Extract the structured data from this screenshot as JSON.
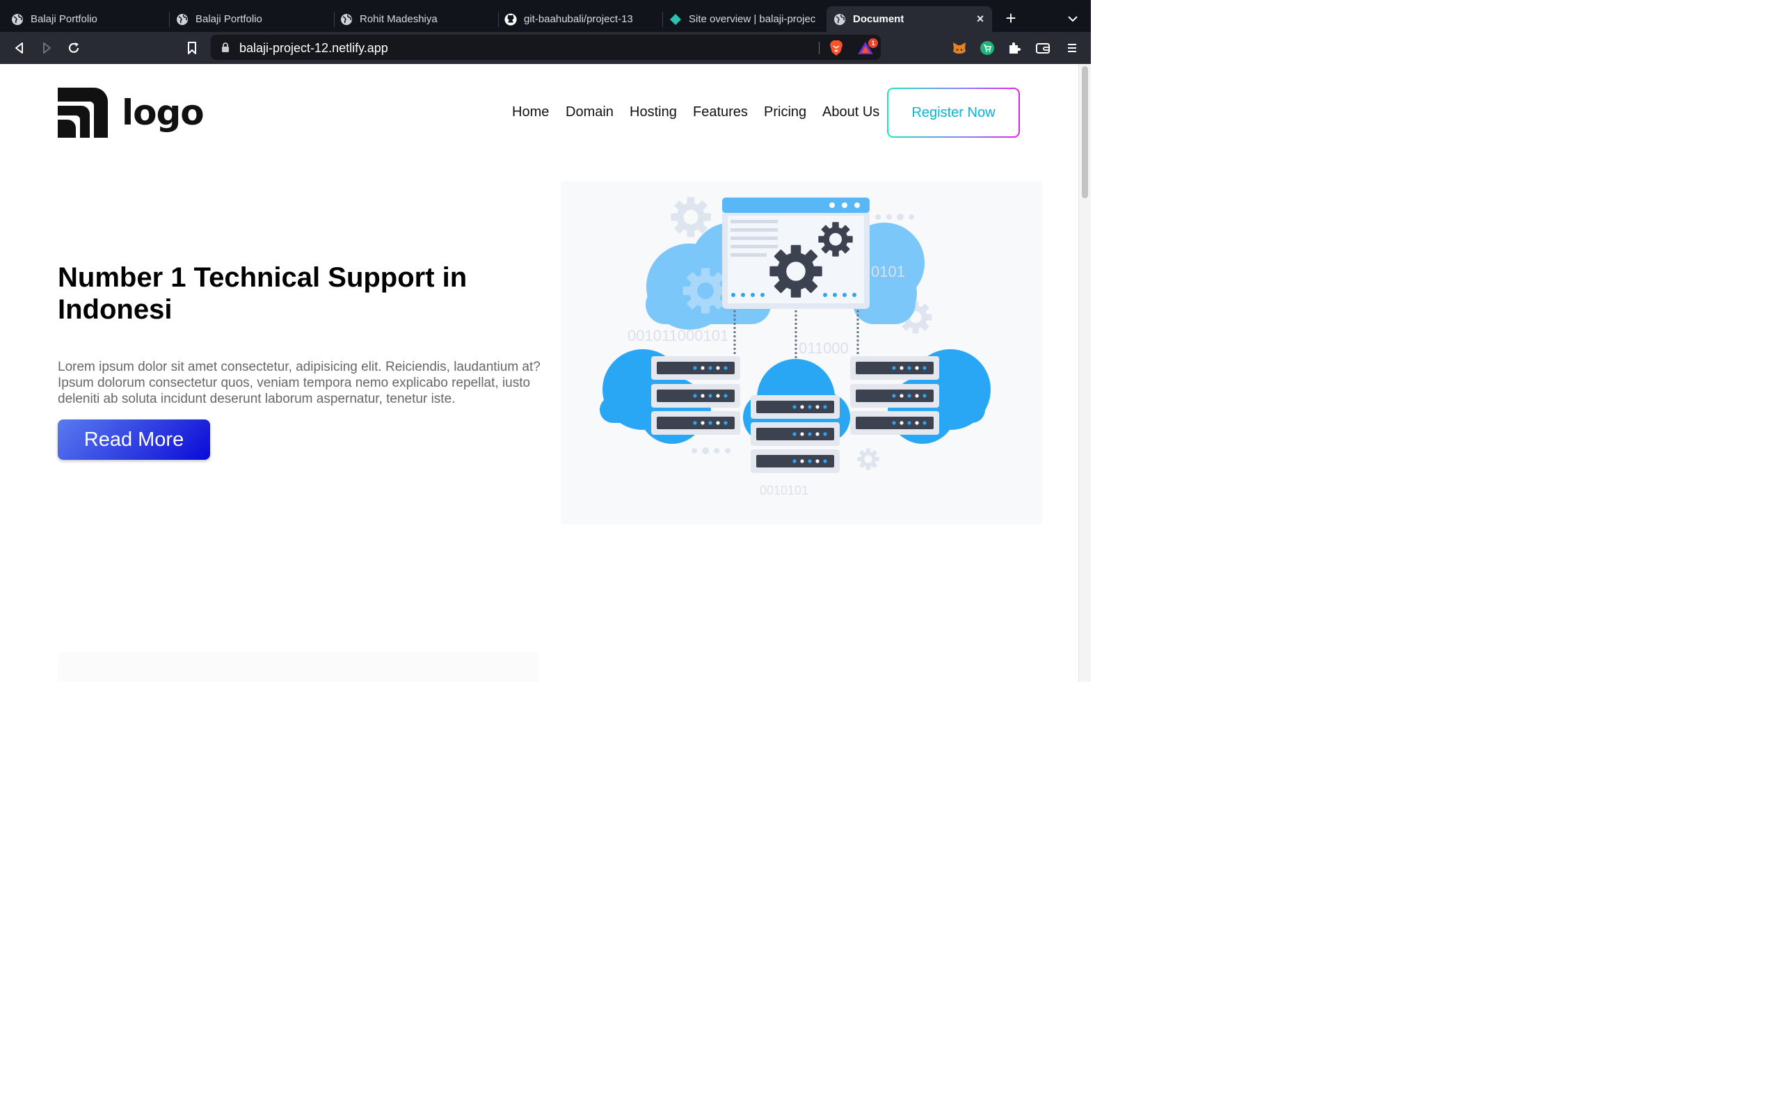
{
  "browser": {
    "tabs": [
      {
        "title": "Balaji Portfolio",
        "icon": "globe-icon",
        "active": false
      },
      {
        "title": "Balaji Portfolio",
        "icon": "globe-icon",
        "active": false
      },
      {
        "title": "Rohit Madeshiya",
        "icon": "globe-icon",
        "active": false
      },
      {
        "title": "git-baahubali/project-13",
        "icon": "github-icon",
        "active": false
      },
      {
        "title": "Site overview | balaji-projec",
        "icon": "netlify-icon",
        "active": false
      },
      {
        "title": "Document",
        "icon": "globe-icon",
        "active": true
      }
    ],
    "new_tab": "+",
    "close_tab": "×",
    "url": "balaji-project-12.netlify.app",
    "rewards_badge": "1",
    "extensions": [
      "metamask-icon",
      "green-extension-icon",
      "puzzle-icon",
      "wallet-icon",
      "menu-icon"
    ]
  },
  "site": {
    "logo_text": "logo",
    "nav": [
      "Home",
      "Domain",
      "Hosting",
      "Features",
      "Pricing",
      "About Us"
    ],
    "register_label": "Register Now",
    "hero": {
      "title": "Number 1 Technical Support in Indonesi",
      "body": "Lorem ipsum dolor sit amet consectetur, adipisicing elit. Reiciendis, laudantium at? Ipsum dolorum consectetur quos, veniam tempora nemo explicabo repellat, iusto deleniti ab soluta incidunt deserunt laborum aspernatur, tenetur iste.",
      "cta": "Read More"
    },
    "illustration": {
      "binary_1": "0101",
      "binary_2": "001011000101",
      "binary_3": "011000",
      "binary_4": "0010101"
    },
    "colors": {
      "accent_blue": "#2f3ee0",
      "cloud_blue": "#2aa7f4",
      "cloud_light": "#7cc7fa",
      "server_dark": "#3c4250",
      "register_gradient_start": "#1fe5b6",
      "register_gradient_end": "#e21fe7"
    }
  }
}
